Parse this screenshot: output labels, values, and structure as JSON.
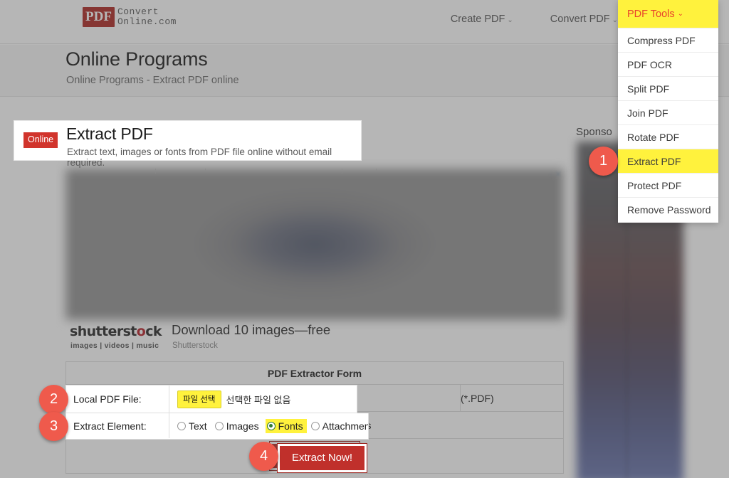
{
  "brand": {
    "badge": "PDF",
    "line1": "Convert",
    "line2": "Online.com"
  },
  "nav": {
    "items": [
      {
        "label": "Create PDF",
        "caret": "chevron-down-icon"
      },
      {
        "label": "Convert PDF",
        "caret": "chevron-down-icon"
      },
      {
        "label": "PDF Tools",
        "caret": "chevron-down-icon"
      }
    ]
  },
  "dropdown": {
    "trigger": "PDF Tools",
    "caret": "⌄",
    "items": [
      {
        "label": "Compress PDF",
        "highlighted": false
      },
      {
        "label": "PDF OCR",
        "highlighted": false
      },
      {
        "label": "Split PDF",
        "highlighted": false
      },
      {
        "label": "Join PDF",
        "highlighted": false
      },
      {
        "label": "Rotate PDF",
        "highlighted": false
      },
      {
        "label": "Extract PDF",
        "highlighted": true
      },
      {
        "label": "Protect PDF",
        "highlighted": false
      },
      {
        "label": "Remove Password",
        "highlighted": false
      }
    ]
  },
  "page_head": {
    "title": "Online Programs",
    "subtitle": "Online Programs - Extract PDF online"
  },
  "tool_card": {
    "badge": "Online",
    "title": "Extract PDF",
    "description": "Extract text, images or fonts from PDF file online without email required."
  },
  "shutterstock": {
    "logo_pre": "shutterst",
    "logo_mark": "o",
    "logo_post": "ck",
    "categories": "images  |  videos  |  music",
    "headline": "Download 10 images—free",
    "brand": "Shutterstock"
  },
  "form": {
    "title": "PDF Extractor Form",
    "file_row": {
      "label": "Local PDF File:",
      "button": "파일 선택",
      "file_status": "선택한 파일 없음",
      "extension_hint": "(*.PDF)"
    },
    "element_row": {
      "label": "Extract Element:",
      "options": [
        {
          "label": "Text",
          "selected": false
        },
        {
          "label": "Images",
          "selected": false
        },
        {
          "label": "Fonts",
          "selected": true
        },
        {
          "label": "Attachments",
          "selected": false
        }
      ]
    },
    "submit": "Extract Now!"
  },
  "sidebar": {
    "sponsored_label": "Sponso"
  },
  "steps": [
    {
      "number": "1"
    },
    {
      "number": "2"
    },
    {
      "number": "3"
    },
    {
      "number": "4"
    }
  ],
  "colors": {
    "brand_red": "#b02b25",
    "highlight_yellow": "#fff23d",
    "accent_red": "#e8412c",
    "submit_red": "#c0302b",
    "step_marker": "#ef5a4c",
    "radio_green": "#2f7a33"
  }
}
